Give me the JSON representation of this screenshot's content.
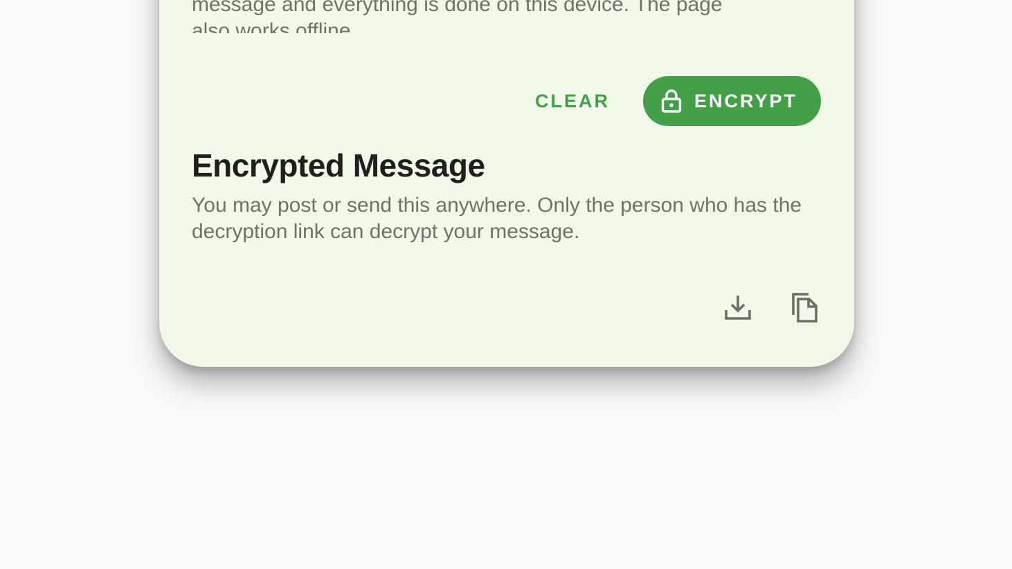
{
  "intro": {
    "line1": "message and everything is done on this device. The page",
    "line2": "also works offline."
  },
  "actions": {
    "clear_label": "CLEAR",
    "encrypt_label": "ENCRYPT",
    "encrypt_icon": "lock-icon"
  },
  "encrypted_section": {
    "title": "Encrypted Message",
    "description": "You may post or send this anywhere. Only the person who has the decryption link can decrypt your message."
  },
  "icons": {
    "download": "download-icon",
    "copy": "copy-icon"
  },
  "colors": {
    "accent": "#43a047",
    "card_background": "#f1f7e9",
    "page_background": "#f9f9f9",
    "secondary_text": "#6e7368",
    "primary_text": "#1e201c"
  }
}
